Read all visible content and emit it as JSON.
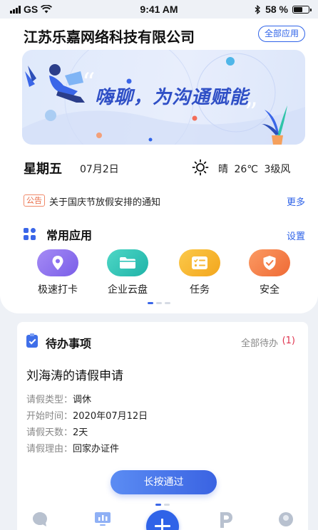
{
  "status_bar": {
    "carrier": "GS",
    "time": "9:41 AM",
    "battery": "58 %",
    "battery_level": 0.58
  },
  "header": {
    "company": "江苏乐嘉网络科技有限公司",
    "all_apps_label": "全部应用"
  },
  "banner": {
    "slogan": "嗨聊，为沟通赋能"
  },
  "info": {
    "weekday": "星期五",
    "date": "07月2日",
    "weather_icon": "sun-icon",
    "weather": "晴",
    "temperature": "26℃",
    "wind": "3级风"
  },
  "notice": {
    "badge": "公告",
    "text": "关于国庆节放假安排的通知",
    "more": "更多"
  },
  "apps": {
    "title": "常用应用",
    "settings_label": "设置",
    "items": [
      {
        "label": "极速打卡",
        "icon": "location-pin-icon",
        "color": "#8a6ef0"
      },
      {
        "label": "企业云盘",
        "icon": "folder-icon",
        "color": "#2fc4b8"
      },
      {
        "label": "任务",
        "icon": "checklist-icon",
        "color": "#f7b733"
      },
      {
        "label": "安全",
        "icon": "shield-icon",
        "color": "#f47a45"
      }
    ]
  },
  "todo": {
    "title": "待办事项",
    "all_label": "全部待办",
    "count": "(1)",
    "request_title": "刘海涛的请假申请",
    "fields": [
      {
        "key": "请假类型：",
        "value": "调休"
      },
      {
        "key": "开始时间：",
        "value": "2020年07月12日"
      },
      {
        "key": "请假天数：",
        "value": "2天"
      },
      {
        "key": "请假理由：",
        "value": "回家办证件"
      }
    ],
    "approve_label": "长按通过"
  },
  "tabbar": {
    "tabs": [
      {
        "icon": "chat-icon"
      },
      {
        "icon": "dashboard-icon"
      },
      {
        "icon": "add-icon"
      },
      {
        "icon": "p-icon"
      },
      {
        "icon": "profile-icon"
      }
    ]
  },
  "colors": {
    "accent": "#2f63e8",
    "notice": "#e86a45",
    "count": "#e0344f"
  }
}
